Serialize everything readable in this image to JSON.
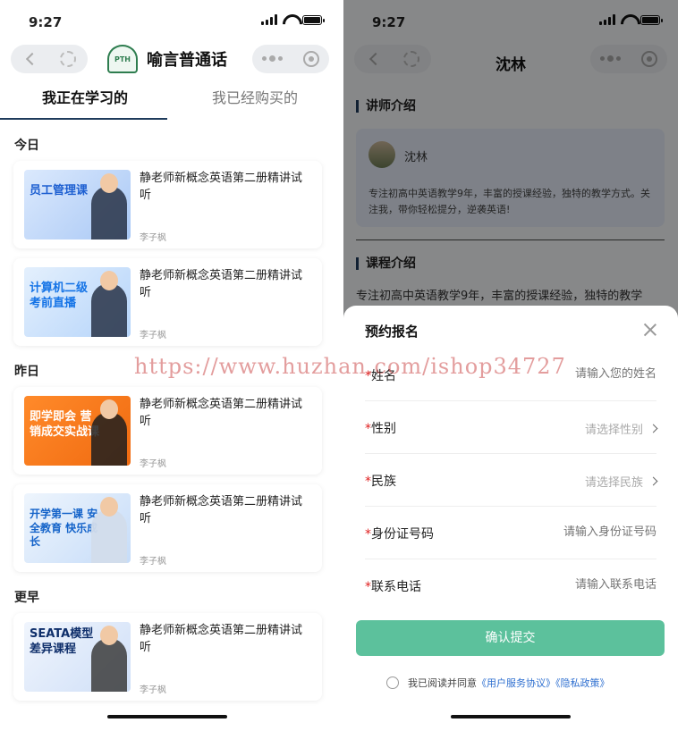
{
  "left_screen": {
    "status_time": "9:27",
    "app_title": "喻言普通话",
    "logo_text": "PTH",
    "tabs": [
      {
        "label": "我正在学习的",
        "active": true
      },
      {
        "label": "我已经购买的",
        "active": false
      }
    ],
    "sections": [
      {
        "title": "今日"
      },
      {
        "title": "昨日"
      },
      {
        "title": "更早"
      }
    ],
    "courses": [
      {
        "thumb_text": "员工管理课",
        "thumb_color": "#cfe1fb",
        "title": "静老师新概念英语第二册精讲试听",
        "author": "李子枫"
      },
      {
        "thumb_text": "计算机二级 考前直播",
        "thumb_color": "#d8e9fb",
        "title": "静老师新概念英语第二册精讲试听",
        "author": "李子枫"
      },
      {
        "thumb_text": "即学即会 营销成交实战课",
        "thumb_color": "#ff7a1f",
        "title": "静老师新概念英语第二册精讲试听",
        "author": "李子枫"
      },
      {
        "thumb_text": "开学第一课 安全教育 快乐成长",
        "thumb_color": "#e3eefb",
        "title": "静老师新概念英语第二册精讲试听",
        "author": "李子枫"
      },
      {
        "thumb_text": "SEATA模型 差异课程",
        "thumb_color": "#e6eefb",
        "title": "静老师新概念英语第二册精讲试听",
        "author": "李子枫"
      }
    ],
    "watermark": "https://www.huzhan.com/ishop34727"
  },
  "right_screen": {
    "status_time": "9:27",
    "page_title": "沈林",
    "teacher_section_title": "讲师介绍",
    "teacher_name": "沈林",
    "teacher_desc": "专注初高中英语教学9年，丰富的授课经验，独特的教学方式。关注我，带你轻松提分，逆袭英语!",
    "course_section_title": "课程介绍",
    "course_desc": "专注初高中英语教学9年，丰富的授课经验，独特的教学",
    "sheet": {
      "title": "预约报名",
      "fields": [
        {
          "label": "姓名",
          "placeholder": "请输入您的姓名",
          "type": "input"
        },
        {
          "label": "性别",
          "placeholder": "请选择性别",
          "type": "select"
        },
        {
          "label": "民族",
          "placeholder": "请选择民族",
          "type": "select"
        },
        {
          "label": "身份证号码",
          "placeholder": "请输入身份证号码",
          "type": "input"
        },
        {
          "label": "联系电话",
          "placeholder": "请输入联系电话",
          "type": "input"
        }
      ],
      "required_mark": "*",
      "submit_label": "确认提交",
      "agree_prefix": "我已阅读并同意",
      "agree_link1": "《用户服务协议》",
      "agree_link2": "《隐私政策》"
    }
  },
  "colors": {
    "accent_green": "#5cc19c",
    "nav_underline": "#1f3b5c",
    "link_blue": "#2e6fd0",
    "required_red": "#e02020"
  }
}
